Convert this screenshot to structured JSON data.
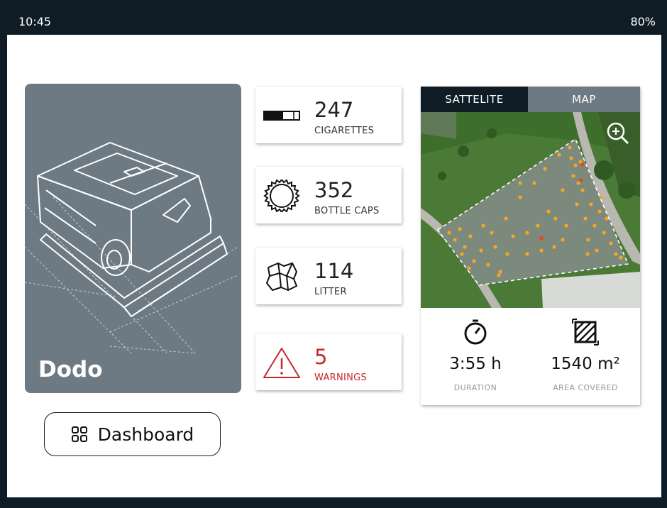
{
  "status_bar": {
    "time": "10:45",
    "battery": "80%"
  },
  "robot": {
    "name": "Dodo"
  },
  "nav": {
    "dashboard_label": "Dashboard"
  },
  "stats": [
    {
      "value": "247",
      "label": "CIGARETTES",
      "icon": "cigarette-icon"
    },
    {
      "value": "352",
      "label": "BOTTLE CAPS",
      "icon": "bottle-cap-icon"
    },
    {
      "value": "114",
      "label": "LITTER",
      "icon": "litter-icon"
    },
    {
      "value": "5",
      "label": "WARNINGS",
      "icon": "warning-icon"
    }
  ],
  "map": {
    "tabs": [
      {
        "label": "SATTELITE",
        "active": true
      },
      {
        "label": "MAP",
        "active": false
      }
    ],
    "metrics": [
      {
        "value": "3:55 h",
        "label": "DURATION",
        "icon": "timer-icon"
      },
      {
        "value": "1540 m²",
        "label": "AREA COVERED",
        "icon": "area-icon"
      }
    ]
  },
  "colors": {
    "dark": "#0f1c26",
    "slate": "#6d7a84",
    "warning": "#c7282a",
    "litter_dot": "#f5a623"
  }
}
